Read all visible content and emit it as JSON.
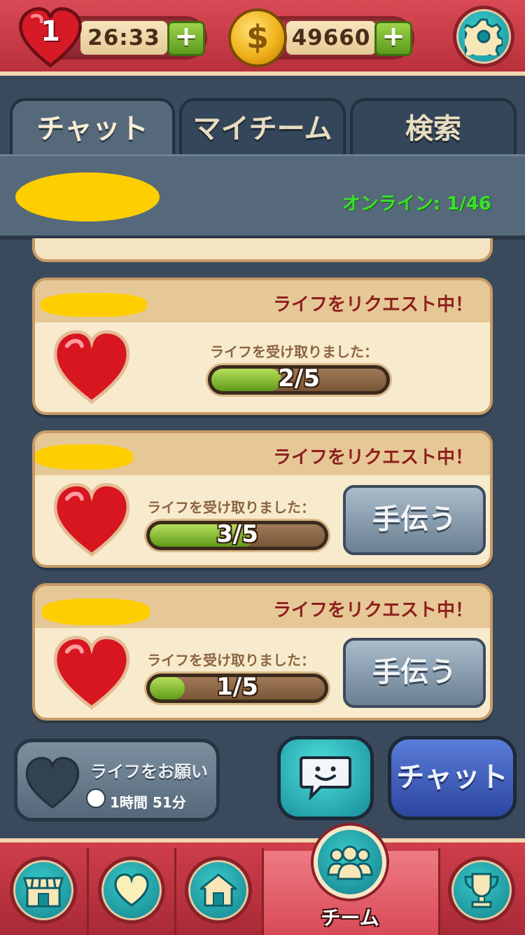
{
  "topbar": {
    "lives_count": "1",
    "lives_timer": "26:33",
    "lives_plus": "+",
    "coins": "49660",
    "coins_plus": "+",
    "coin_symbol": "$"
  },
  "tabs": [
    {
      "label": "チャット",
      "active": true
    },
    {
      "label": "マイチーム",
      "active": false
    },
    {
      "label": "検索",
      "active": false
    }
  ],
  "team_header": {
    "online_text": "オンライン: 1/46"
  },
  "requests": [
    {
      "status": "ライフをリクエスト中！",
      "received_label": "ライフを受け取りました：",
      "progress_text": "2/5",
      "progress": 0.4,
      "help_label": ""
    },
    {
      "status": "ライフをリクエスト中！",
      "received_label": "ライフを受け取りました：",
      "progress_text": "3/5",
      "progress": 0.6,
      "help_label": "手伝う"
    },
    {
      "status": "ライフをリクエスト中！",
      "received_label": "ライフを受け取りました：",
      "progress_text": "1/5",
      "progress": 0.2,
      "help_label": "手伝う"
    }
  ],
  "actions": {
    "ask_lives_label": "ライフをお願い",
    "ask_lives_timer": "1時間 51分",
    "chat_label": "チャット"
  },
  "bottom_nav": {
    "items": [
      {
        "icon": "shop-icon"
      },
      {
        "icon": "heart-icon"
      },
      {
        "icon": "home-icon"
      },
      {
        "icon": "team-icon",
        "label": "チーム",
        "active": true
      },
      {
        "icon": "trophy-icon"
      }
    ]
  },
  "colors": {
    "accent_red": "#c53542",
    "online_green": "#3be02c",
    "status_red": "#8e1f1f",
    "progress_green": "#7cb82e"
  }
}
